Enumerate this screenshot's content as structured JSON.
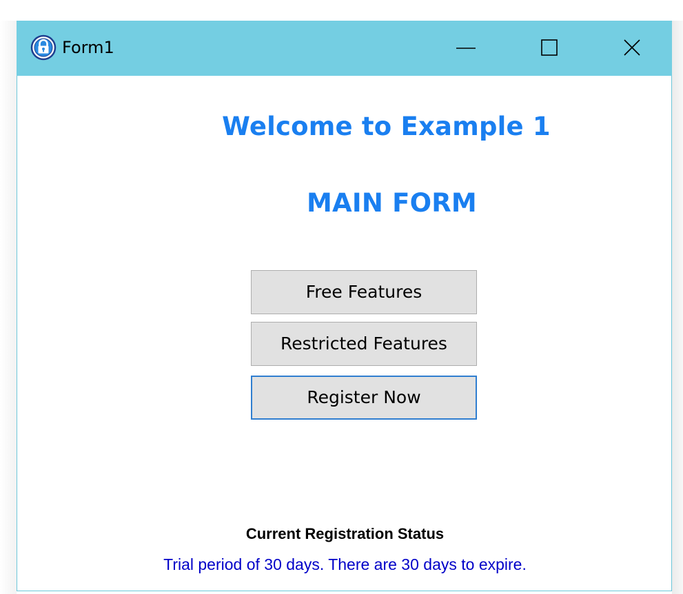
{
  "window": {
    "title": "Form1",
    "icon": "padlock-icon",
    "controls": {
      "minimize_icon": "minimize-icon",
      "maximize_icon": "maximize-icon",
      "close_icon": "close-icon"
    }
  },
  "main": {
    "welcome": "Welcome to Example 1",
    "form_title": "MAIN FORM",
    "buttons": {
      "free": "Free Features",
      "restricted": "Restricted Features",
      "register": "Register Now"
    }
  },
  "status": {
    "label": "Current Registration Status",
    "text": "Trial period of 30 days. There are 30 days to expire."
  },
  "colors": {
    "titlebar": "#74cee2",
    "heading": "#1a7ff0",
    "status_text": "#0000c8",
    "focus_border": "#2f7ed0"
  }
}
